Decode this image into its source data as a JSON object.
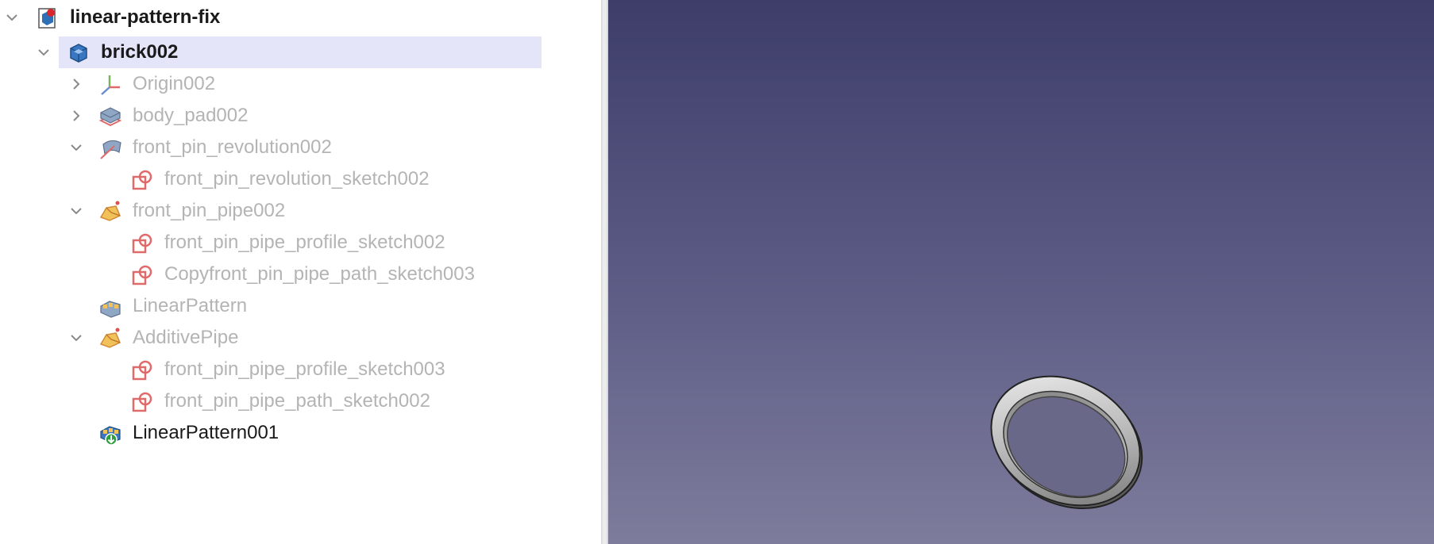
{
  "tree": {
    "items": [
      {
        "label": "linear-pattern-fix",
        "icon": "document-icon",
        "expanded": true
      },
      {
        "label": "brick002",
        "icon": "body-icon",
        "expanded": true,
        "selected": true
      },
      {
        "label": "Origin002",
        "icon": "origin-axes-icon",
        "expanded": false
      },
      {
        "label": "body_pad002",
        "icon": "pad-icon",
        "expanded": false
      },
      {
        "label": "front_pin_revolution002",
        "icon": "revolution-icon",
        "expanded": true
      },
      {
        "label": "front_pin_revolution_sketch002",
        "icon": "sketch-icon"
      },
      {
        "label": "front_pin_pipe002",
        "icon": "additive-pipe-icon",
        "expanded": true
      },
      {
        "label": "front_pin_pipe_profile_sketch002",
        "icon": "sketch-icon"
      },
      {
        "label": "Copyfront_pin_pipe_path_sketch003",
        "icon": "sketch-icon"
      },
      {
        "label": "LinearPattern",
        "icon": "linear-pattern-icon"
      },
      {
        "label": "AdditivePipe",
        "icon": "additive-pipe-icon",
        "expanded": true
      },
      {
        "label": "front_pin_pipe_profile_sketch003",
        "icon": "sketch-icon"
      },
      {
        "label": "front_pin_pipe_path_sketch002",
        "icon": "sketch-icon"
      },
      {
        "label": "LinearPattern001",
        "icon": "linear-pattern-tip-icon"
      }
    ]
  },
  "viewport": {
    "background_top": "#3e3d6a",
    "background_bottom": "#7d7c9c",
    "object": "ring-model"
  },
  "colors": {
    "selection": "#e5e5fa",
    "faded_text": "#b4b4b4",
    "sketch_red": "#e06a6a"
  }
}
